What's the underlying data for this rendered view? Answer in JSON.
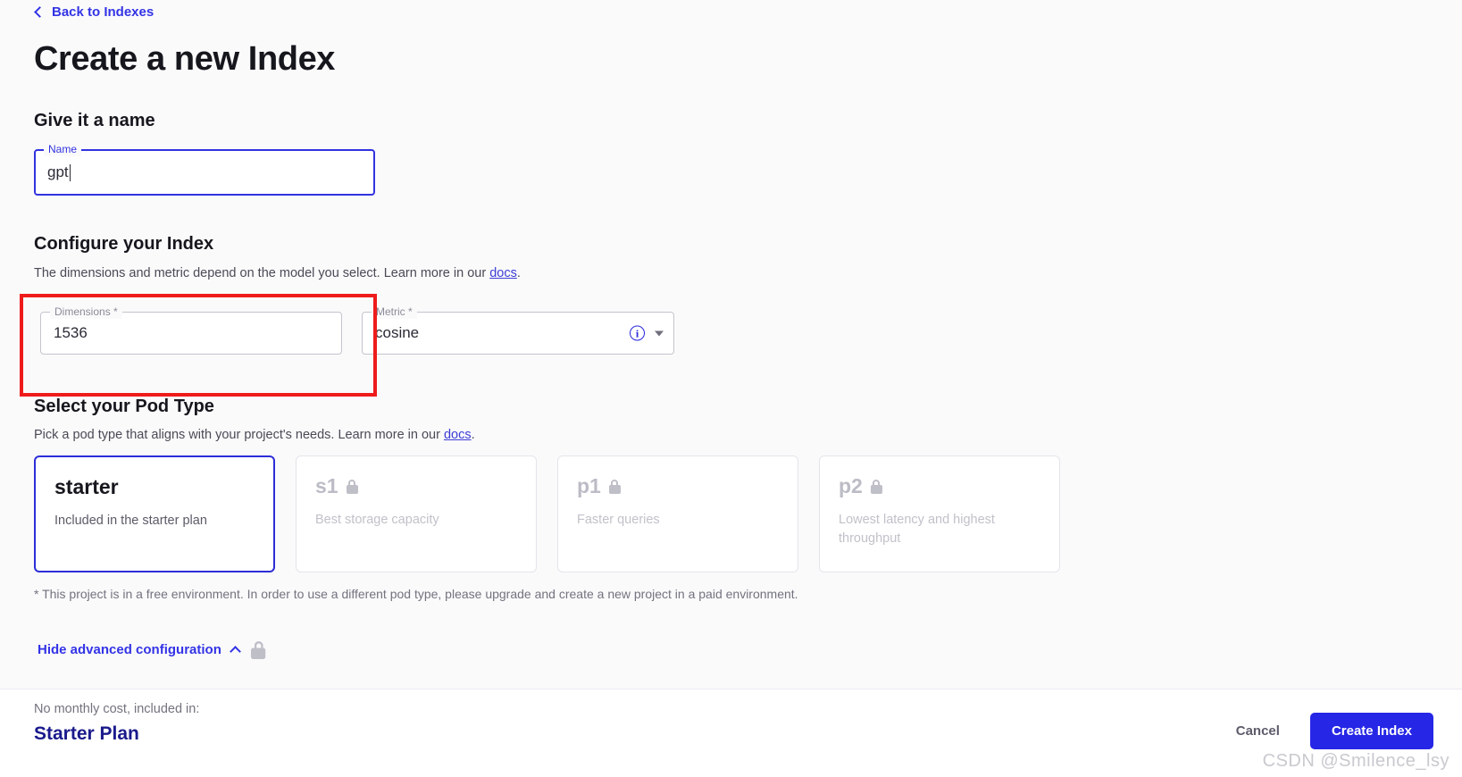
{
  "header": {
    "back_label": "Back to Indexes",
    "title": "Create a new Index"
  },
  "name_section": {
    "heading": "Give it a name",
    "field_label": "Name",
    "value": "gpt"
  },
  "config_section": {
    "heading": "Configure your Index",
    "description_before": "The dimensions and metric depend on the model you select. Learn more in our ",
    "docs_link": "docs",
    "description_after": ".",
    "dimensions_label": "Dimensions *",
    "dimensions_value": "1536",
    "metric_label": "Metric *",
    "metric_value": "cosine",
    "info_icon": "info-icon",
    "dropdown_icon": "chevron-down-icon"
  },
  "pod_section": {
    "heading": "Select your Pod Type",
    "description_before": "Pick a pod type that aligns with your project's needs. Learn more in our ",
    "docs_link": "docs",
    "description_after": ".",
    "cards": [
      {
        "name": "starter",
        "desc": "Included in the starter plan",
        "locked": false,
        "selected": true
      },
      {
        "name": "s1",
        "desc": "Best storage capacity",
        "locked": true,
        "selected": false
      },
      {
        "name": "p1",
        "desc": "Faster queries",
        "locked": true,
        "selected": false
      },
      {
        "name": "p2",
        "desc": "Lowest latency and highest throughput",
        "locked": true,
        "selected": false
      }
    ],
    "footnote": "* This project is in a free environment. In order to use a different pod type, please upgrade and create a new project in a paid environment."
  },
  "advanced": {
    "label": "Hide advanced configuration",
    "chevron_icon": "chevron-up-icon",
    "lock_icon": "lock-icon"
  },
  "footer": {
    "cost_label": "No monthly cost, included in:",
    "plan_name": "Starter Plan",
    "cancel_label": "Cancel",
    "create_label": "Create Index"
  },
  "watermark": "CSDN @Smilence_lsy",
  "colors": {
    "accent_blue": "#2626e6",
    "link_blue": "#3333e6",
    "plan_blue": "#1a1a8c",
    "annotation_red": "#ef1b1b",
    "page_bg": "#fafafb"
  }
}
